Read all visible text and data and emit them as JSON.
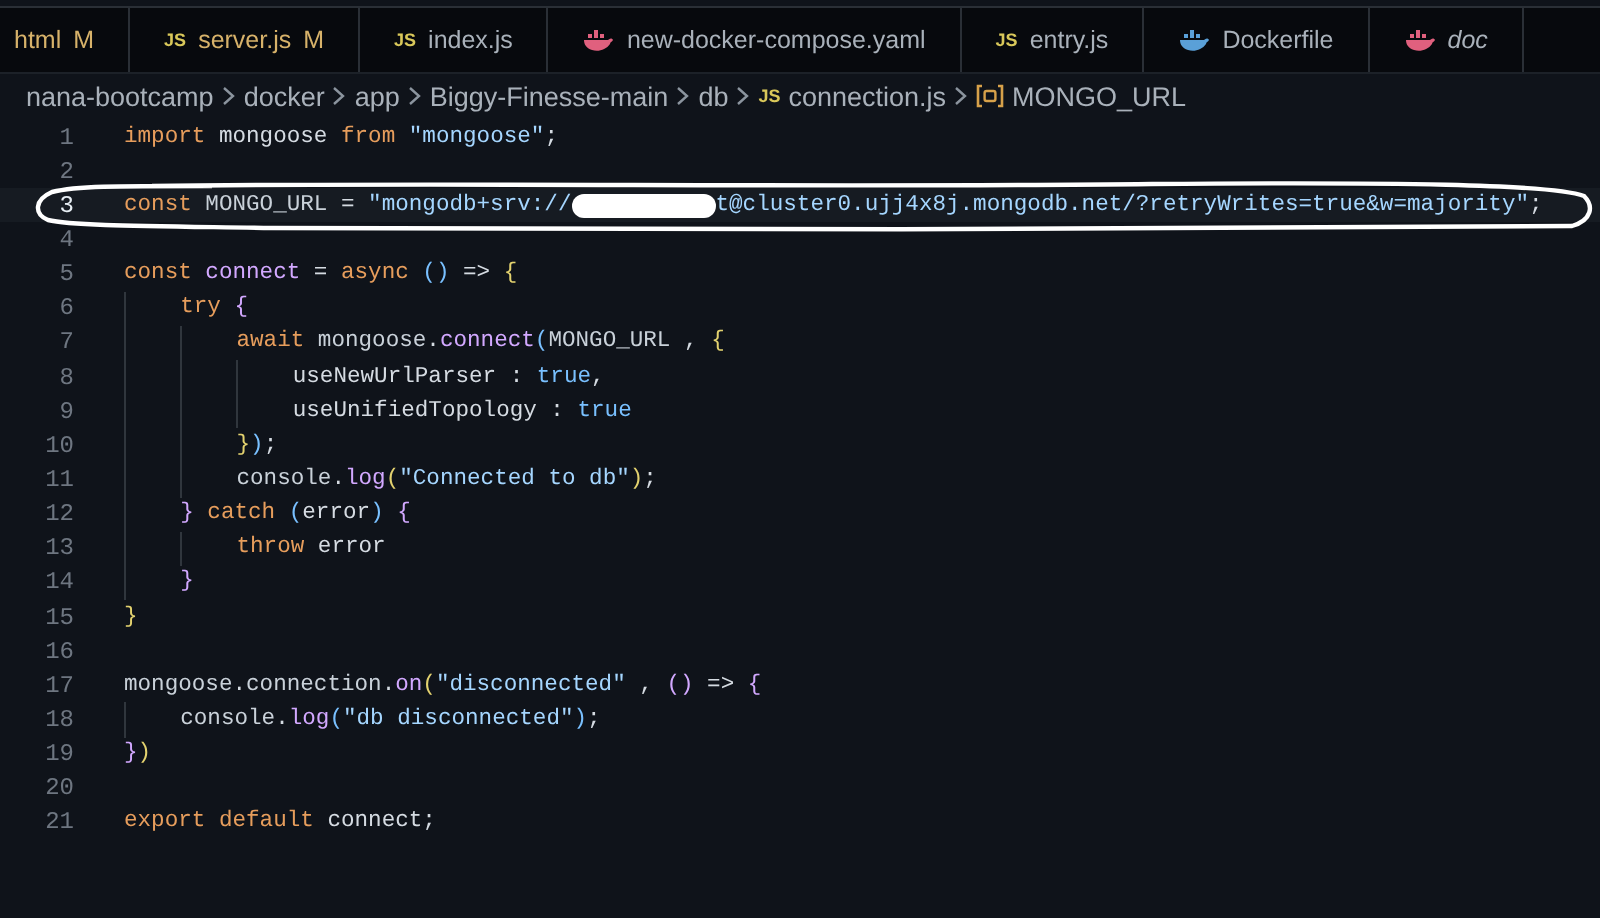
{
  "tabs": [
    {
      "label": "html",
      "badge": "M",
      "modified": true,
      "selected": false,
      "preview": false,
      "icon": {
        "kind": "none"
      }
    },
    {
      "label": "server.js",
      "badge": "M",
      "modified": true,
      "selected": false,
      "preview": false,
      "icon": {
        "kind": "js",
        "text": "JS"
      }
    },
    {
      "label": "index.js",
      "modified": false,
      "selected": false,
      "preview": false,
      "icon": {
        "kind": "js",
        "text": "JS"
      }
    },
    {
      "label": "new-docker-compose.yaml",
      "modified": false,
      "selected": false,
      "preview": false,
      "icon": {
        "kind": "whale",
        "color": "#e0607e"
      }
    },
    {
      "label": "entry.js",
      "modified": false,
      "selected": false,
      "preview": false,
      "icon": {
        "kind": "js",
        "text": "JS"
      }
    },
    {
      "label": "Dockerfile",
      "modified": false,
      "selected": false,
      "preview": false,
      "icon": {
        "kind": "whale",
        "color": "#5aa0d8"
      }
    },
    {
      "label": "doc",
      "modified": false,
      "selected": false,
      "preview": true,
      "icon": {
        "kind": "whale",
        "color": "#e0607e"
      }
    }
  ],
  "breadcrumb": [
    {
      "kind": "folder",
      "label": "nana-bootcamp"
    },
    {
      "kind": "folder",
      "label": "docker"
    },
    {
      "kind": "folder",
      "label": "app"
    },
    {
      "kind": "folder",
      "label": "Biggy-Finesse-main"
    },
    {
      "kind": "folder",
      "label": "db"
    },
    {
      "kind": "file",
      "icon_text": "JS",
      "label": "connection.js"
    },
    {
      "kind": "symbol",
      "label": "MONGO_URL"
    }
  ],
  "editor": {
    "lines": [
      {
        "number": "1",
        "current": false,
        "circled": false,
        "tokens": [
          {
            "kind": "kw",
            "text": "import"
          },
          {
            "kind": "plain",
            "text": " mongoose "
          },
          {
            "kind": "kw",
            "text": "from"
          },
          {
            "kind": "str",
            "text": " \"mongoose\""
          },
          {
            "kind": "plain",
            "text": ";"
          }
        ]
      },
      {
        "number": "2",
        "current": false,
        "circled": false
      },
      {
        "number": "3",
        "current": true,
        "circled": true,
        "tokens": [
          {
            "kind": "kw",
            "text": "const"
          },
          {
            "kind": "var",
            "text": " MONGO_URL"
          },
          {
            "kind": "plain",
            "text": " = "
          },
          {
            "kind": "str",
            "text": "\"mongodb+srv://"
          },
          {
            "kind": "redacted"
          },
          {
            "kind": "str",
            "text": "t@cluster0.ujj4x8j.mongodb.net/?retryWrites=true&w=majority\""
          },
          {
            "kind": "plain",
            "text": ";"
          }
        ]
      },
      {
        "number": "4",
        "current": false,
        "circled": false
      },
      {
        "number": "5",
        "current": false,
        "circled": false,
        "tokens": [
          {
            "kind": "kw",
            "text": "const"
          },
          {
            "kind": "fn",
            "text": " connect"
          },
          {
            "kind": "plain",
            "text": " = "
          },
          {
            "kind": "kw",
            "text": "async"
          },
          {
            "kind": "b3",
            "text": " ()"
          },
          {
            "kind": "plain",
            "text": " => "
          },
          {
            "kind": "b1",
            "text": "{"
          }
        ]
      },
      {
        "number": "6",
        "current": false,
        "circled": false,
        "tokens": [
          {
            "kind": "kw",
            "text": "    try"
          },
          {
            "kind": "b2",
            "text": " {"
          }
        ]
      },
      {
        "number": "7",
        "current": false,
        "circled": false,
        "tokens": [
          {
            "kind": "kw",
            "text": "        await"
          },
          {
            "kind": "var",
            "text": " mongoose"
          },
          {
            "kind": "plain",
            "text": "."
          },
          {
            "kind": "fn",
            "text": "connect"
          },
          {
            "kind": "b3",
            "text": "("
          },
          {
            "kind": "var",
            "text": "MONGO_URL"
          },
          {
            "kind": "plain",
            "text": " , "
          },
          {
            "kind": "b1",
            "text": "{"
          }
        ]
      },
      {
        "number": "8",
        "current": false,
        "circled": false,
        "tokens": [
          {
            "kind": "plain",
            "text": "            useNewUrlParser : "
          },
          {
            "kind": "bool",
            "text": "true"
          },
          {
            "kind": "plain",
            "text": ","
          }
        ]
      },
      {
        "number": "9",
        "current": false,
        "circled": false,
        "tokens": [
          {
            "kind": "plain",
            "text": "            useUnifiedTopology : "
          },
          {
            "kind": "bool",
            "text": "true"
          }
        ]
      },
      {
        "number": "10",
        "current": false,
        "circled": false,
        "tokens": [
          {
            "kind": "b1",
            "text": "        }"
          },
          {
            "kind": "b3",
            "text": ")"
          },
          {
            "kind": "plain",
            "text": ";"
          }
        ]
      },
      {
        "number": "11",
        "current": false,
        "circled": false,
        "tokens": [
          {
            "kind": "var",
            "text": "        console"
          },
          {
            "kind": "plain",
            "text": "."
          },
          {
            "kind": "fn",
            "text": "log"
          },
          {
            "kind": "b1",
            "text": "("
          },
          {
            "kind": "str",
            "text": "\"Connected to db\""
          },
          {
            "kind": "b1",
            "text": ")"
          },
          {
            "kind": "plain",
            "text": ";"
          }
        ]
      },
      {
        "number": "12",
        "current": false,
        "circled": false,
        "tokens": [
          {
            "kind": "b2",
            "text": "    }"
          },
          {
            "kind": "kw",
            "text": " catch"
          },
          {
            "kind": "b3",
            "text": " ("
          },
          {
            "kind": "plain",
            "text": "error"
          },
          {
            "kind": "b3",
            "text": ")"
          },
          {
            "kind": "b2",
            "text": " {"
          }
        ]
      },
      {
        "number": "13",
        "current": false,
        "circled": false,
        "tokens": [
          {
            "kind": "kw",
            "text": "        throw"
          },
          {
            "kind": "plain",
            "text": " error"
          }
        ]
      },
      {
        "number": "14",
        "current": false,
        "circled": false,
        "tokens": [
          {
            "kind": "b2",
            "text": "    }"
          }
        ]
      },
      {
        "number": "15",
        "current": false,
        "circled": false,
        "tokens": [
          {
            "kind": "b1",
            "text": "}"
          }
        ]
      },
      {
        "number": "16",
        "current": false,
        "circled": false
      },
      {
        "number": "17",
        "current": false,
        "circled": false,
        "tokens": [
          {
            "kind": "var",
            "text": "mongoose"
          },
          {
            "kind": "plain",
            "text": "."
          },
          {
            "kind": "var",
            "text": "connection"
          },
          {
            "kind": "plain",
            "text": "."
          },
          {
            "kind": "fn",
            "text": "on"
          },
          {
            "kind": "b1",
            "text": "("
          },
          {
            "kind": "str",
            "text": "\"disconnected\""
          },
          {
            "kind": "plain",
            "text": " , "
          },
          {
            "kind": "b2",
            "text": "()"
          },
          {
            "kind": "plain",
            "text": " => "
          },
          {
            "kind": "b2",
            "text": "{"
          }
        ]
      },
      {
        "number": "18",
        "current": false,
        "circled": false,
        "tokens": [
          {
            "kind": "var",
            "text": "    console"
          },
          {
            "kind": "plain",
            "text": "."
          },
          {
            "kind": "fn",
            "text": "log"
          },
          {
            "kind": "b3",
            "text": "("
          },
          {
            "kind": "str",
            "text": "\"db disconnected\""
          },
          {
            "kind": "b3",
            "text": ")"
          },
          {
            "kind": "plain",
            "text": ";"
          }
        ]
      },
      {
        "number": "19",
        "current": false,
        "circled": false,
        "tokens": [
          {
            "kind": "b2",
            "text": "}"
          },
          {
            "kind": "b1",
            "text": ")"
          }
        ]
      },
      {
        "number": "20",
        "current": false,
        "circled": false
      },
      {
        "number": "21",
        "current": false,
        "circled": false,
        "tokens": [
          {
            "kind": "kw",
            "text": "export"
          },
          {
            "kind": "kw",
            "text": " default"
          },
          {
            "kind": "plain",
            "text": " connect;"
          }
        ]
      }
    ]
  }
}
